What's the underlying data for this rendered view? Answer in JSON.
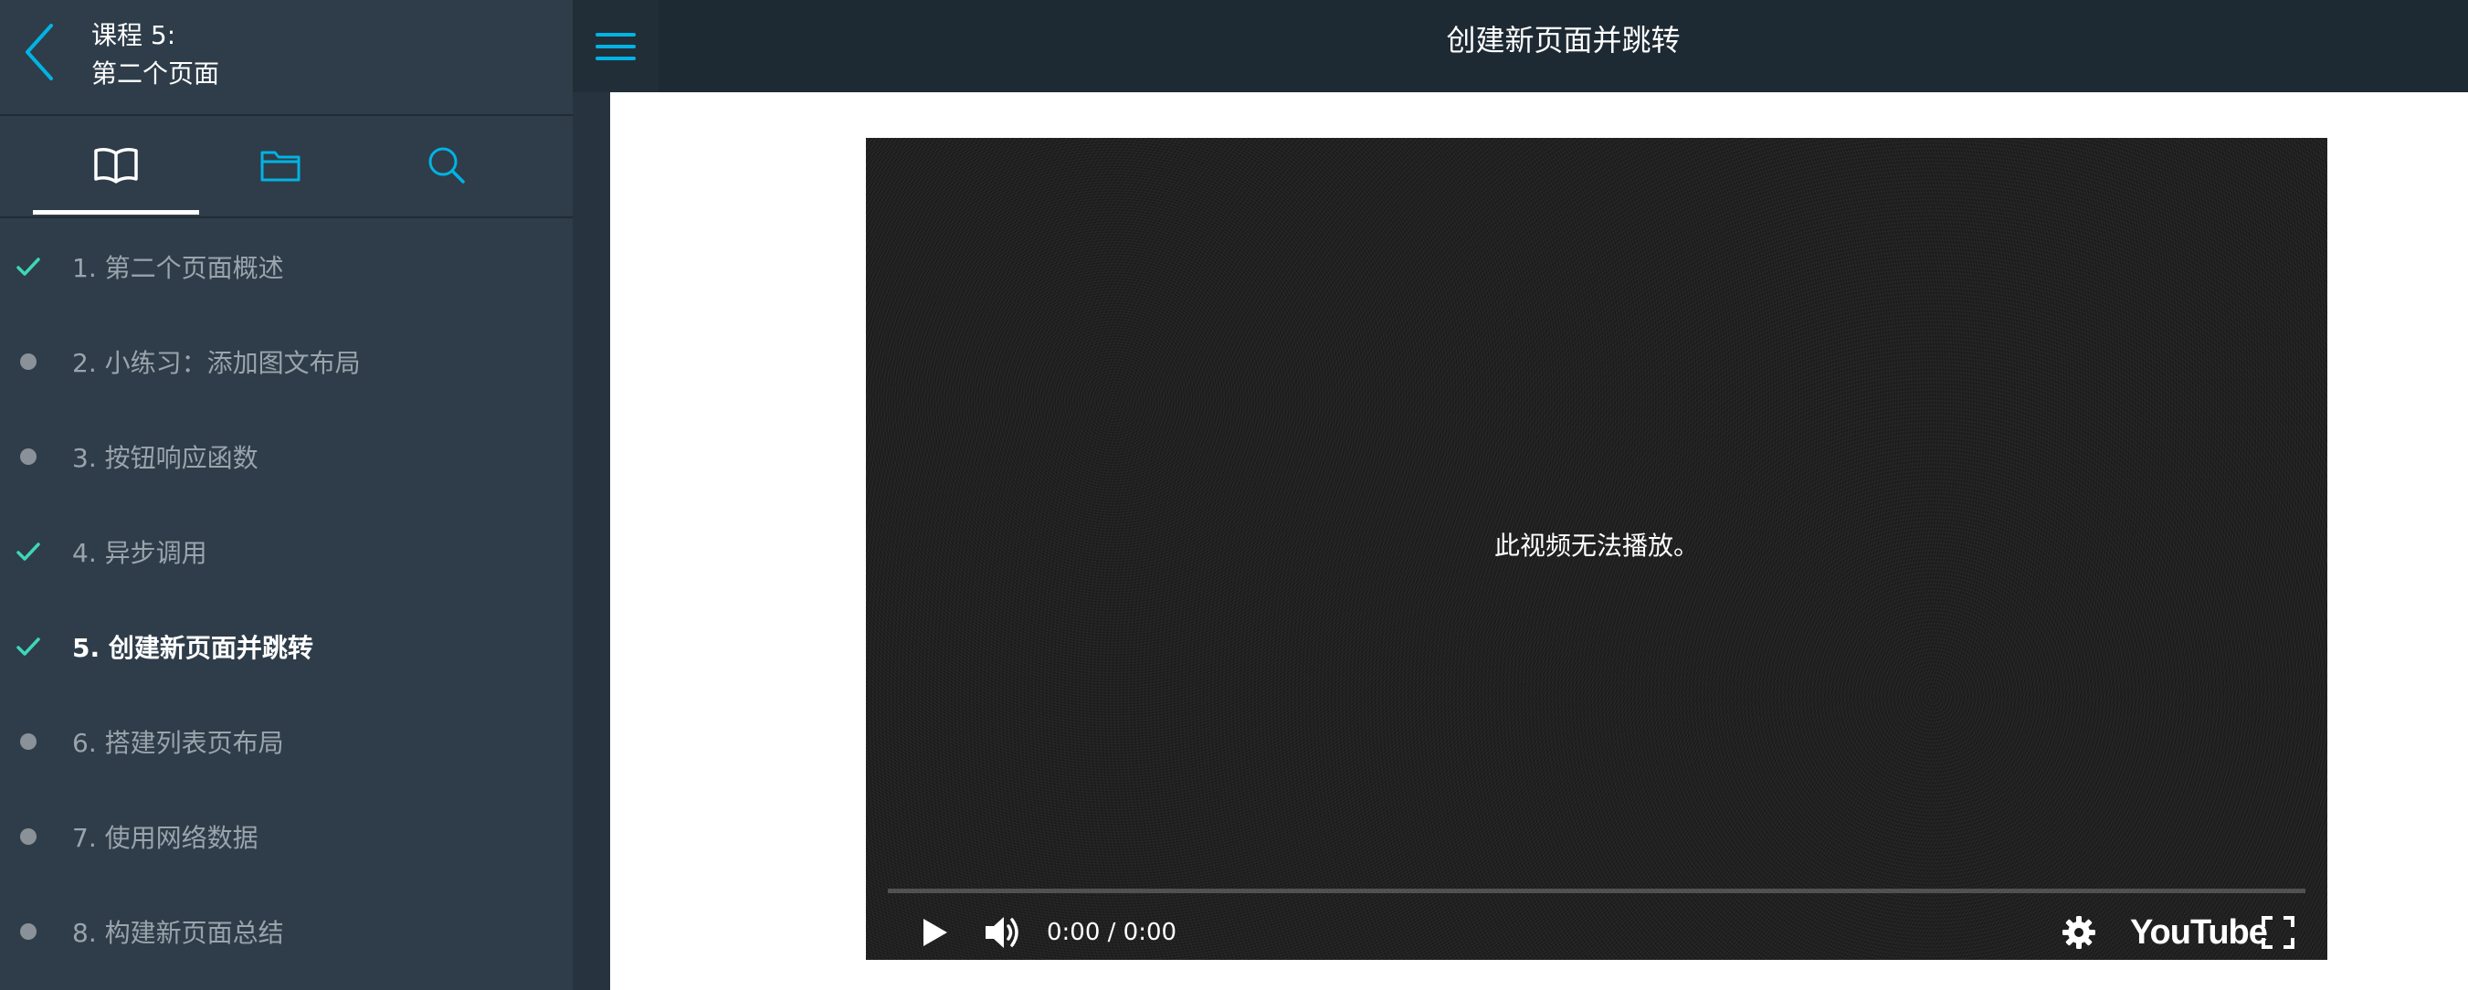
{
  "sidebar": {
    "course_title": "课程 5:",
    "course_subtitle": "第二个页面",
    "tabs": [
      {
        "name": "lessons",
        "icon": "book-icon",
        "active": true
      },
      {
        "name": "resources",
        "icon": "folder-icon",
        "active": false
      },
      {
        "name": "search",
        "icon": "search-icon",
        "active": false
      }
    ],
    "lessons": [
      {
        "label": "1. 第二个页面概述",
        "status": "completed"
      },
      {
        "label": "2. 小练习：添加图文布局",
        "status": "not-started"
      },
      {
        "label": "3. 按钮响应函数",
        "status": "not-started"
      },
      {
        "label": "4. 异步调用",
        "status": "completed"
      },
      {
        "label": "5. 创建新页面并跳转",
        "status": "completed",
        "current": true
      },
      {
        "label": "6. 搭建列表页布局",
        "status": "not-started"
      },
      {
        "label": "7. 使用网络数据",
        "status": "not-started"
      },
      {
        "label": "8. 构建新页面总结",
        "status": "not-started"
      }
    ]
  },
  "header": {
    "title": "创建新页面并跳转"
  },
  "video": {
    "message": "此视频无法播放。",
    "time": "0:00 / 0:00",
    "progress": 0,
    "brand": "YouTube"
  },
  "colors": {
    "sidebar_bg": "#2e3d49",
    "topbar_bg": "#1e2a33",
    "accent_blue": "#02b3e4",
    "check_teal": "#3ed6b8",
    "dot_gray": "#8a9198"
  }
}
